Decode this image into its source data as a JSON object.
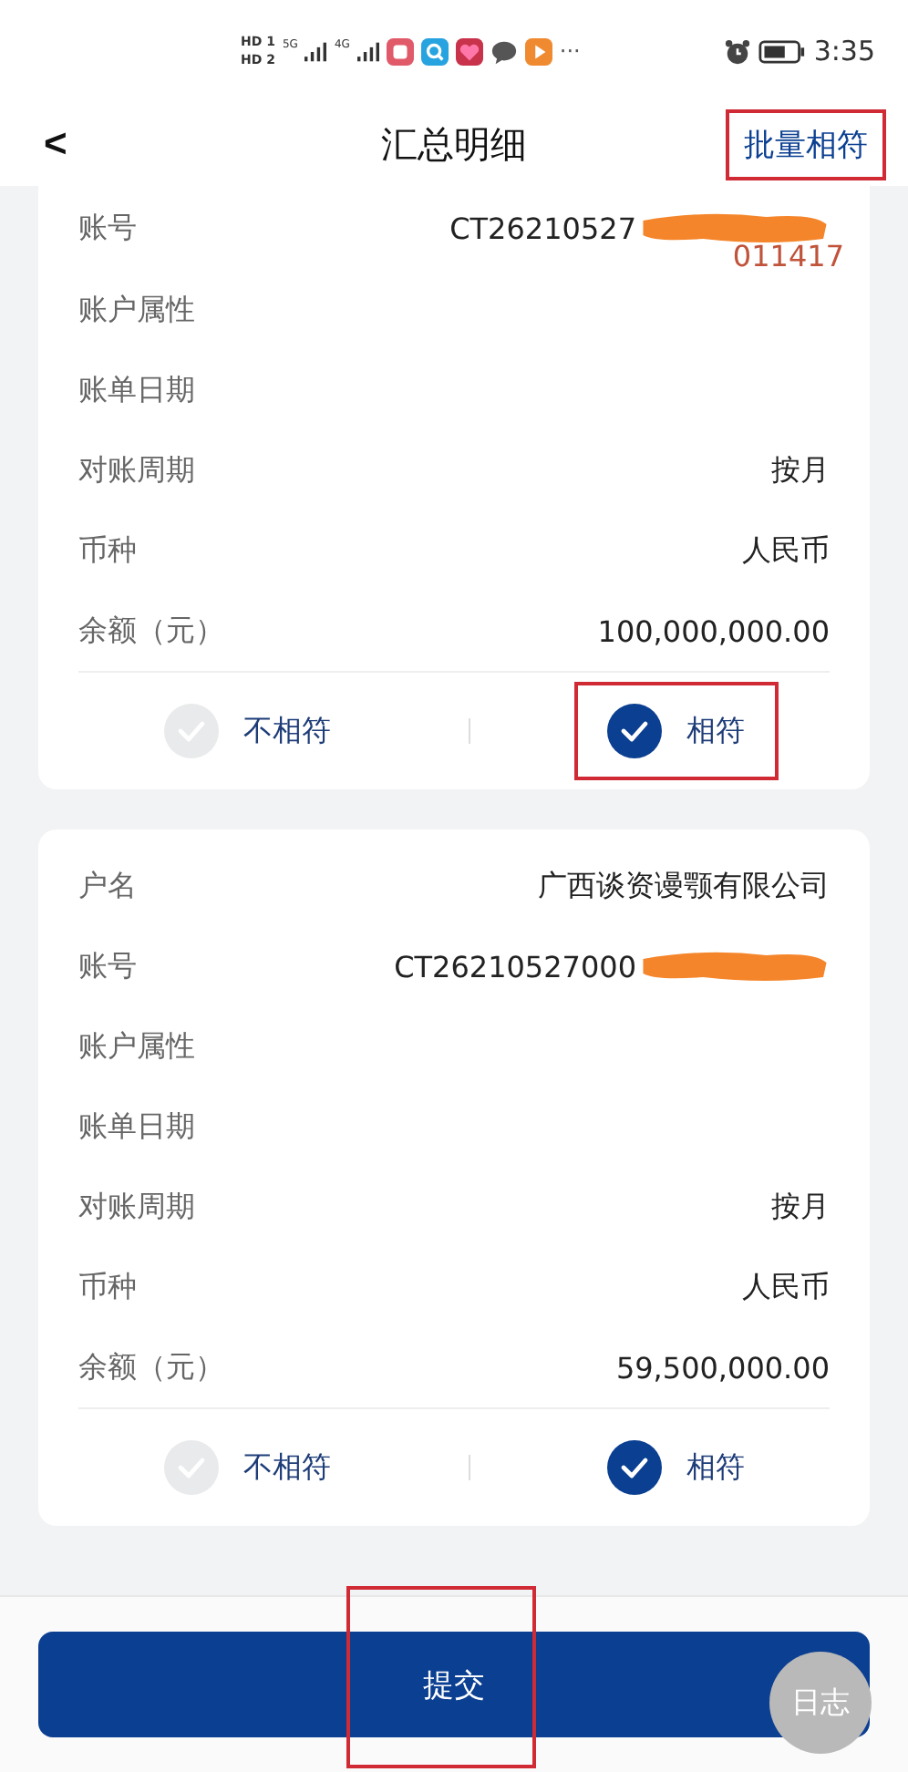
{
  "status_bar": {
    "sim_labels": [
      "HD 1",
      "HD 2"
    ],
    "network": [
      "5G",
      "4G"
    ],
    "overflow": "···",
    "time": "3:35"
  },
  "header": {
    "back": "<",
    "title": "汇总明细",
    "action": {
      "label": "批量相符",
      "highlighted": true
    }
  },
  "cards": [
    {
      "rows": [
        {
          "label": "账号",
          "value": "CT26210527",
          "redacted": true,
          "suffix": "011417"
        },
        {
          "label": "账户属性"
        },
        {
          "label": "账单日期"
        },
        {
          "label": "对账周期",
          "value": "按月"
        },
        {
          "label": "币种",
          "value": "人民币"
        },
        {
          "label": "余额（元）",
          "value": "100,000,000.00"
        }
      ],
      "options": [
        {
          "label": "不相符",
          "selected": false,
          "highlighted": false
        },
        {
          "label": "相符",
          "selected": true,
          "highlighted": true
        }
      ]
    },
    {
      "rows": [
        {
          "label": "户名",
          "value": "广西谈资谩颚有限公司"
        },
        {
          "label": "账号",
          "value": "CT26210527000",
          "redacted": true
        },
        {
          "label": "账户属性"
        },
        {
          "label": "账单日期"
        },
        {
          "label": "对账周期",
          "value": "按月"
        },
        {
          "label": "币种",
          "value": "人民币"
        },
        {
          "label": "余额（元）",
          "value": "59,500,000.00"
        }
      ],
      "options": [
        {
          "label": "不相符",
          "selected": false,
          "highlighted": false
        },
        {
          "label": "相符",
          "selected": true,
          "highlighted": false
        }
      ]
    }
  ],
  "footer": {
    "submit": {
      "label": "提交",
      "highlighted": true
    },
    "log_button": "日志"
  }
}
